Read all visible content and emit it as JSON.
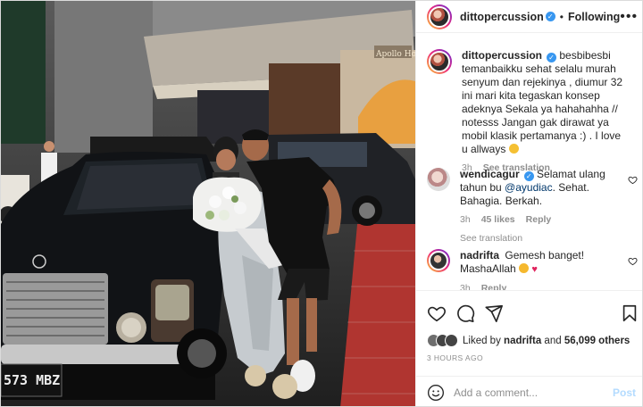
{
  "post": {
    "author": "dittopercussion",
    "follow_label": "Following",
    "separator": "•",
    "caption": "besbibesbi temanbaikku sehat selalu murah senyum dan rejekinya , diumur 32 ini mari kita tegaskan konsep adeknya Sekala ya hahahahha // notesss Jangan gak dirawat ya mobil klasik pertamanya :) . I love u allways",
    "caption_time": "3h",
    "see_translation": "See translation",
    "photo_sign": "Apollo Hotel",
    "photo_plate": "573 MBZ"
  },
  "comments": [
    {
      "username": "wendicagur",
      "text_before": "Selamat ulang tahun bu ",
      "mention": "@ayudiac",
      "text_after": ". Sehat. Bahagia. Berkah.",
      "time": "3h",
      "likes": "45 likes",
      "reply": "Reply",
      "see_translation": "See translation"
    },
    {
      "username": "nadrifta",
      "text": "Gemesh banget! MashaAllah",
      "time": "3h",
      "reply": "Reply"
    }
  ],
  "likes": {
    "prefix": "Liked by",
    "first_user": "nadrifta",
    "connector": "and",
    "others": "56,099 others"
  },
  "time_ago": "3 HOURS AGO",
  "add_comment": {
    "placeholder": "Add a comment...",
    "post_label": "Post"
  },
  "colors": {
    "accent": "#3897f0",
    "post_disabled": "#b3dbff",
    "mention": "#00376b"
  },
  "icons": [
    "heart-icon",
    "comment-icon",
    "share-icon",
    "bookmark-icon",
    "emoji-icon",
    "more-icon",
    "verified-icon"
  ]
}
